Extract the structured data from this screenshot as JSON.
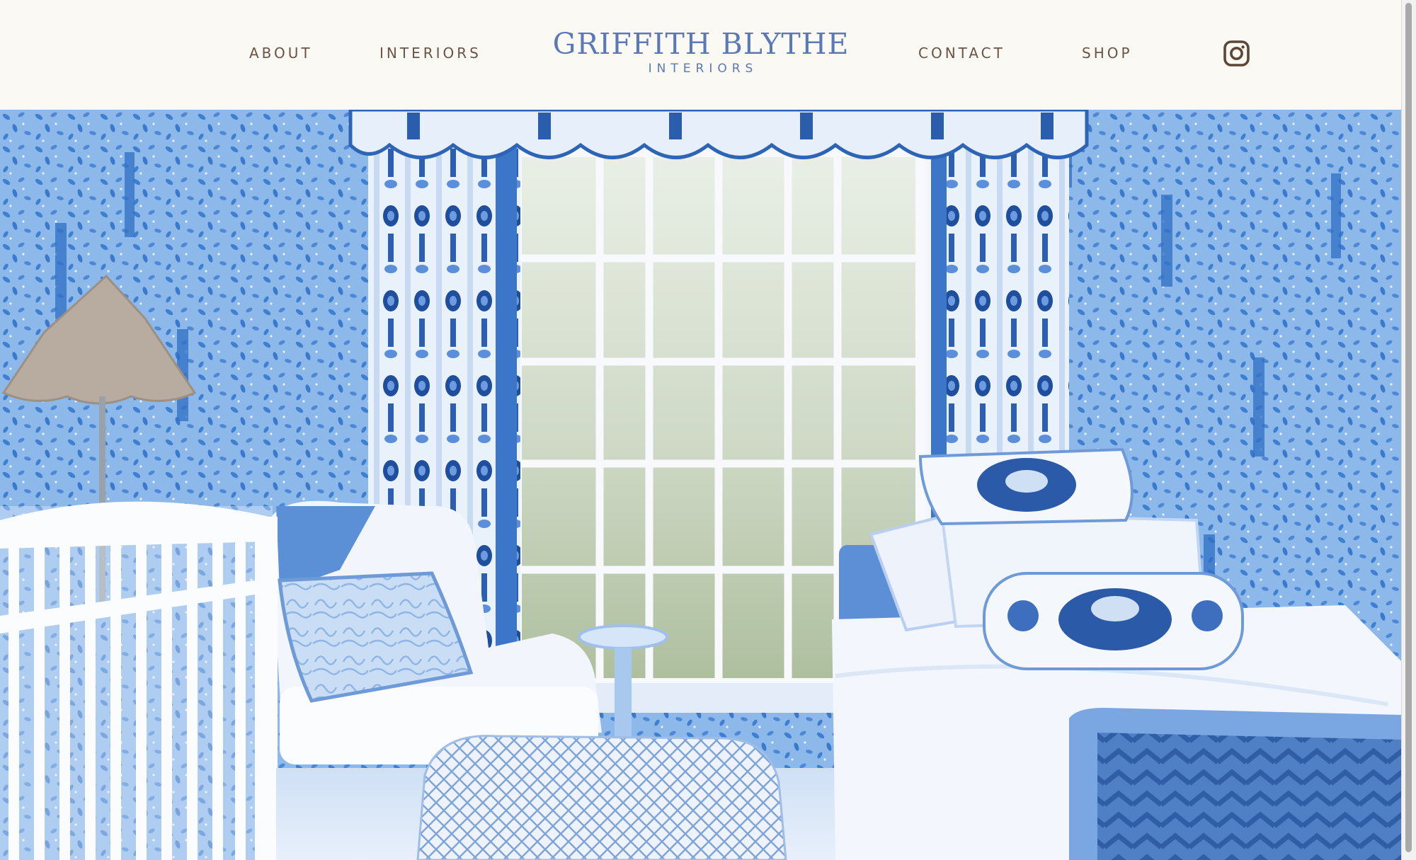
{
  "header": {
    "nav_left": [
      {
        "label": "ABOUT"
      },
      {
        "label": "INTERIORS"
      }
    ],
    "nav_right": [
      {
        "label": "CONTACT"
      },
      {
        "label": "SHOP"
      }
    ],
    "logo": {
      "title": "GRIFFITH BLYTHE",
      "subtitle": "INTERIORS"
    },
    "social_icon": "instagram-icon"
  },
  "hero": {
    "image": "blue-and-white-nursery-photo",
    "alt": "Blue and white nursery with patterned wallpaper, curtains, crib, armchair, pouf and daybed"
  },
  "colors": {
    "background": "#fbf9f4",
    "nav_text": "#6b5347",
    "brand_blue": "#5b79b6",
    "icon": "#5e4536"
  }
}
